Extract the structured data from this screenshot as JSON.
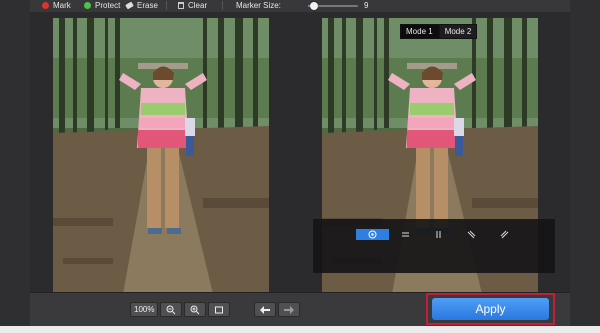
{
  "toolbar": {
    "mark_label": "Mark",
    "protect_label": "Protect",
    "erase_label": "Erase",
    "clear_label": "Clear",
    "marker_size_label": "Marker Size:",
    "marker_size_value": "9",
    "marker_size_level": 0.12,
    "colors": {
      "mark": "#d9352b",
      "protect": "#4cc34a",
      "accent": "#2f7fe0"
    }
  },
  "mode_switch": {
    "mode1": "Mode 1",
    "mode2": "Mode 2",
    "active": "mode1"
  },
  "brush_panel": {
    "icons": [
      "target-icon",
      "equals-icon",
      "pause-icon",
      "slash-back-icon",
      "slash-forward-icon"
    ],
    "selected": 0
  },
  "bottom_bar": {
    "zoom_value": "100%",
    "zoom_out_icon": "zoom-out-icon",
    "zoom_in_icon": "zoom-in-icon",
    "fit_icon": "fit-screen-icon",
    "undo_icon": "undo-arrow-icon",
    "redo_icon": "redo-arrow-icon",
    "apply_label": "Apply"
  }
}
